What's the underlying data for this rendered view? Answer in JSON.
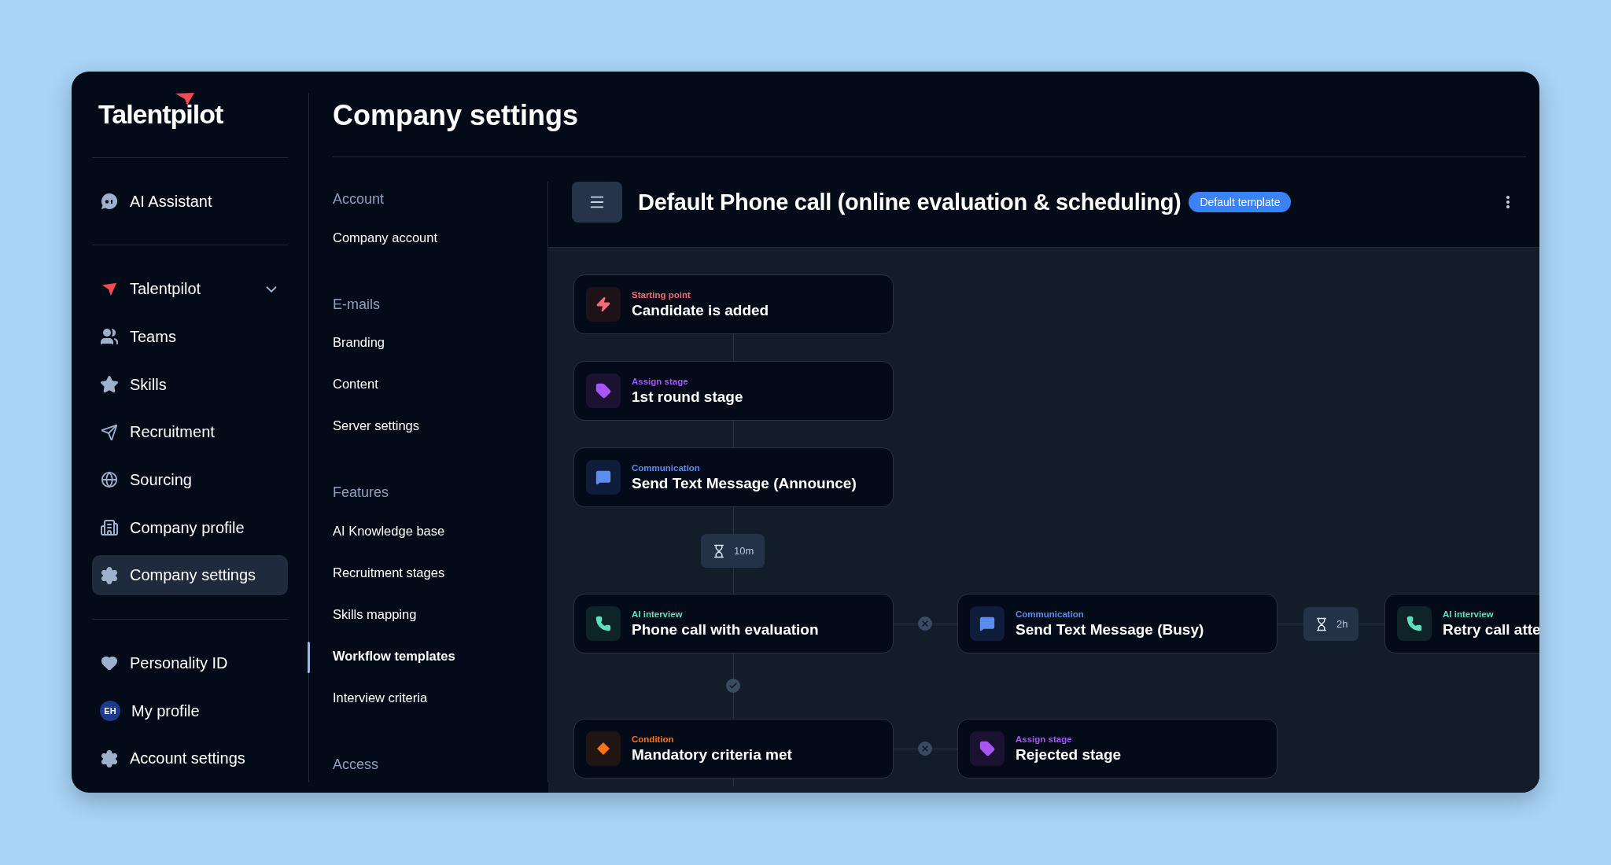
{
  "sidebar": {
    "logo": "Talentpilot",
    "groups": [
      [
        {
          "label": "AI Assistant",
          "kind": "link",
          "selected": false
        }
      ],
      [
        {
          "label": "Talentpilot",
          "kind": "workspace",
          "selected": false
        },
        {
          "label": "Teams",
          "kind": "link",
          "selected": false
        },
        {
          "label": "Skills",
          "kind": "link",
          "selected": false
        },
        {
          "label": "Recruitment",
          "kind": "link",
          "selected": false
        },
        {
          "label": "Sourcing",
          "kind": "link",
          "selected": false
        },
        {
          "label": "Company profile",
          "kind": "link",
          "selected": false
        },
        {
          "label": "Company settings",
          "kind": "link",
          "selected": true
        }
      ],
      [
        {
          "label": "Personality ID",
          "kind": "link",
          "selected": false
        },
        {
          "label": "My profile",
          "kind": "avatar",
          "initials": "EH",
          "selected": false
        },
        {
          "label": "Account settings",
          "kind": "link",
          "selected": false
        }
      ]
    ]
  },
  "page": {
    "title": "Company settings"
  },
  "settings_nav": [
    {
      "heading": "Account",
      "items": [
        {
          "label": "Company account",
          "selected": false
        }
      ]
    },
    {
      "heading": "E-mails",
      "items": [
        {
          "label": "Branding",
          "selected": false
        },
        {
          "label": "Content",
          "selected": false
        },
        {
          "label": "Server settings",
          "selected": false
        }
      ]
    },
    {
      "heading": "Features",
      "items": [
        {
          "label": "AI Knowledge base",
          "selected": false
        },
        {
          "label": "Recruitment stages",
          "selected": false
        },
        {
          "label": "Skills mapping",
          "selected": false
        },
        {
          "label": "Workflow templates",
          "selected": true
        },
        {
          "label": "Interview criteria",
          "selected": false
        }
      ]
    },
    {
      "heading": "Access"
    }
  ],
  "workflow": {
    "title": "Default Phone call (online evaluation & scheduling)",
    "badge": "Default template",
    "nodes": [
      {
        "kind": "trigger",
        "category": "Starting point",
        "title": "Candidate is added"
      },
      {
        "kind": "stage",
        "category": "Assign stage",
        "title": "1st round stage"
      },
      {
        "kind": "message",
        "category": "Communication",
        "title": "Send Text Message (Announce)"
      },
      {
        "kind": "call",
        "category": "AI interview",
        "title": "Phone call with evaluation"
      },
      {
        "kind": "message",
        "category": "Communication",
        "title": "Send Text Message (Busy)"
      },
      {
        "kind": "call",
        "category": "AI interview",
        "title": "Retry call atte"
      },
      {
        "kind": "condition",
        "category": "Condition",
        "title": "Mandatory criteria met"
      },
      {
        "kind": "stage",
        "category": "Assign stage",
        "title": "Rejected stage"
      }
    ],
    "timers": [
      {
        "label": "10m"
      },
      {
        "label": "2h"
      }
    ],
    "branches": [
      {
        "kind": "no"
      },
      {
        "kind": "yes"
      },
      {
        "kind": "no"
      }
    ]
  }
}
